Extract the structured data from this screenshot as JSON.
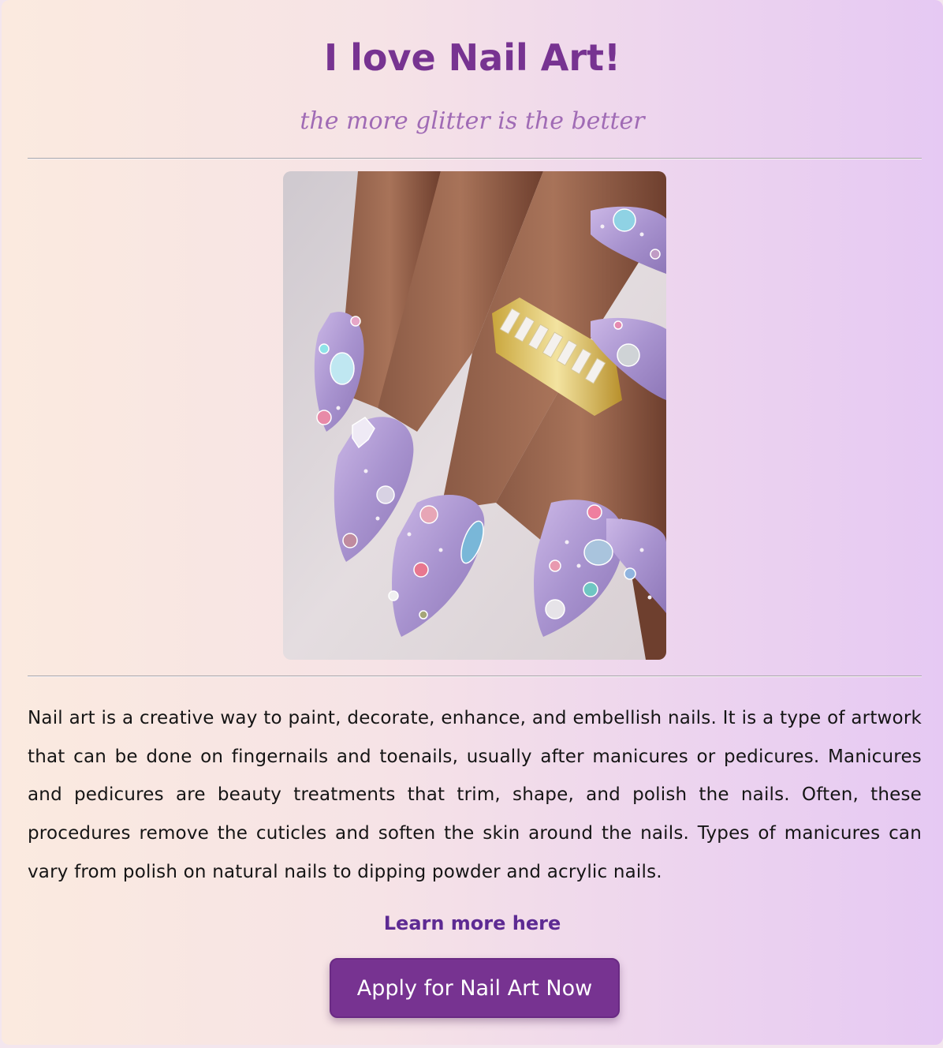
{
  "header": {
    "title": "I love Nail Art!",
    "subtitle": "the more glitter is the better"
  },
  "content": {
    "paragraph": "Nail art is a creative way to paint, decorate, enhance, and embellish nails. It is a type of artwork that can be done on fingernails and toenails, usually after manicures or pedicures. Manicures and pedicures are beauty treatments that trim, shape, and polish the nails. Often, these procedures remove the cuticles and soften the skin around the nails. Types of manicures can vary from polish on natural nails to dipping powder and acrylic nails."
  },
  "links": {
    "learn_more_label": "Learn more here"
  },
  "actions": {
    "apply_label": "Apply for Nail Art Now"
  },
  "colors": {
    "brand_purple": "#773391",
    "subtitle_purple": "#a06bb5",
    "link_purple": "#5d2a93",
    "gradient_start": "#fbeadf",
    "gradient_end": "#e6c9f3"
  }
}
